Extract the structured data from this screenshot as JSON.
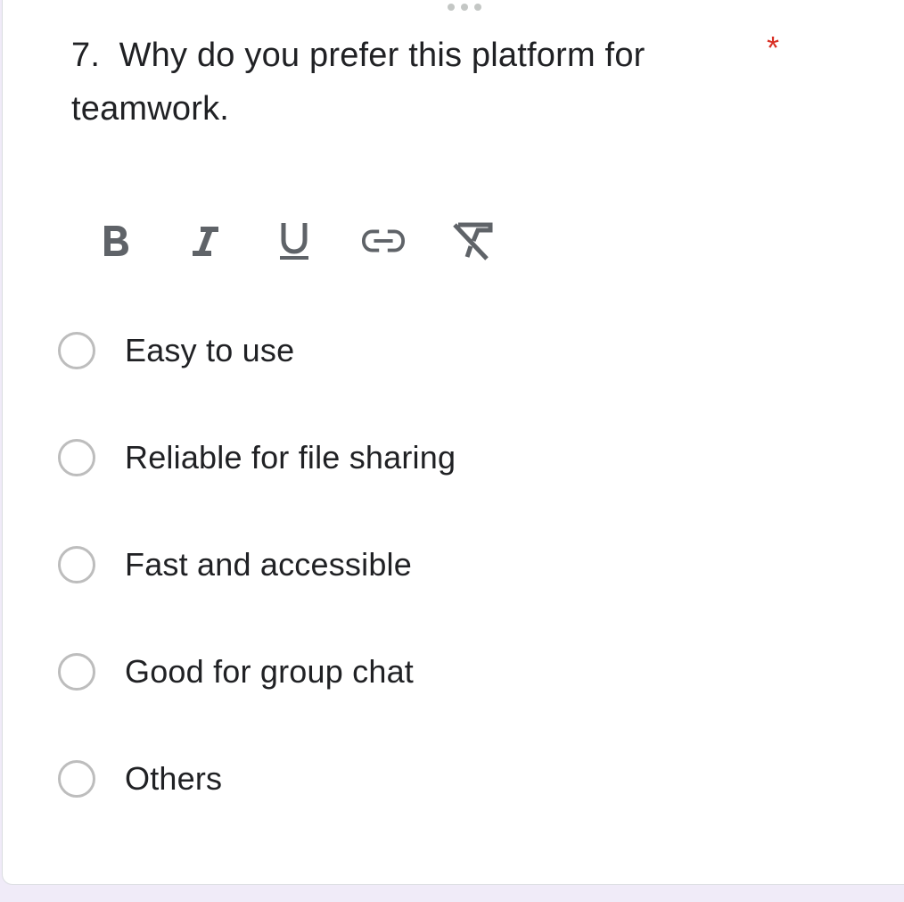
{
  "question": {
    "number": "7.",
    "title": "Why do you prefer this platform for teamwork.",
    "required_marker": "*"
  },
  "toolbar": {
    "tools": [
      "bold-icon",
      "italic-icon",
      "underline-icon",
      "link-icon",
      "clear-format-icon"
    ]
  },
  "options": [
    {
      "label": "Easy to use"
    },
    {
      "label": "Reliable for file sharing"
    },
    {
      "label": "Fast and accessible"
    },
    {
      "label": "Good for group chat"
    },
    {
      "label": "Others"
    }
  ],
  "colors": {
    "required": "#d93025",
    "text": "#202124",
    "icon": "#5f6368",
    "radio_border": "#bdbdbd",
    "background": "#f0ebf8"
  }
}
